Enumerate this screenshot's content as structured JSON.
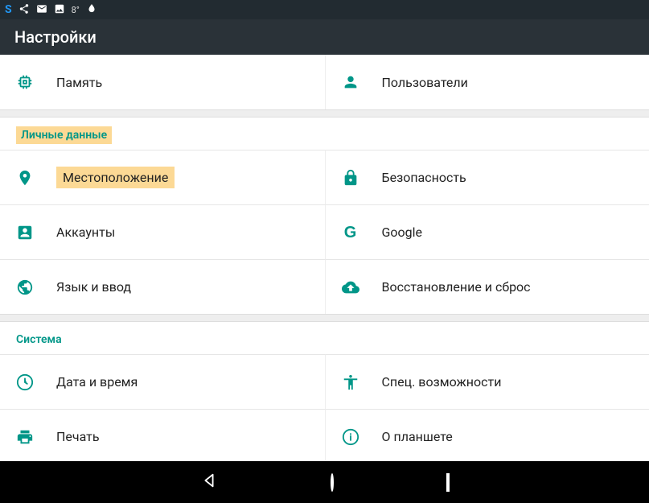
{
  "statusbar": {
    "temp": "8°"
  },
  "appbar": {
    "title": "Настройки"
  },
  "top": {
    "left": {
      "label": "Память"
    },
    "right": {
      "label": "Пользователи"
    }
  },
  "personal": {
    "header": "Личные данные",
    "location": "Местоположение",
    "security": "Безопасность",
    "accounts": "Аккаунты",
    "google": "Google",
    "lang": "Язык и ввод",
    "backup": "Восстановление и сброс"
  },
  "system": {
    "header": "Система",
    "datetime": "Дата и время",
    "accessibility": "Спец. возможности",
    "print": "Печать",
    "about": "О планшете"
  }
}
